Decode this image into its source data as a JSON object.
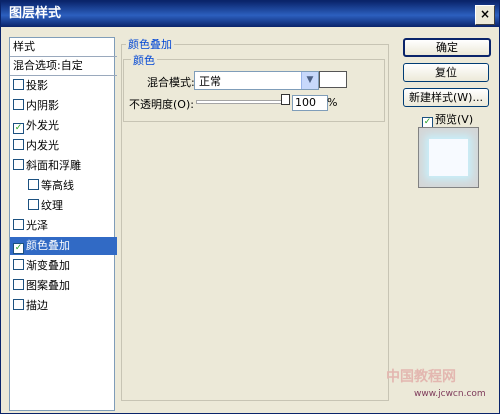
{
  "window": {
    "title": "图层样式",
    "close_glyph": "×"
  },
  "styles_list": {
    "header": "样式",
    "blend_options": "混合选项:自定",
    "items": [
      {
        "label": "投影",
        "checked": false
      },
      {
        "label": "内阴影",
        "checked": false
      },
      {
        "label": "外发光",
        "checked": true
      },
      {
        "label": "内发光",
        "checked": false
      },
      {
        "label": "斜面和浮雕",
        "checked": false
      },
      {
        "label": "等高线",
        "checked": false
      },
      {
        "label": "纹理",
        "checked": false
      },
      {
        "label": "光泽",
        "checked": false
      },
      {
        "label": "颜色叠加",
        "checked": true,
        "selected": true
      },
      {
        "label": "渐变叠加",
        "checked": false
      },
      {
        "label": "图案叠加",
        "checked": false
      },
      {
        "label": "描边",
        "checked": false
      }
    ]
  },
  "color_overlay": {
    "group_title": "颜色叠加",
    "sub_title": "颜色",
    "blend_mode_label": "混合模式:",
    "blend_mode_value": "正常",
    "overlay_color": "#ffffff",
    "opacity_label": "不透明度(O):",
    "opacity_value": "100",
    "opacity_unit": "%"
  },
  "buttons": {
    "ok": "确定",
    "reset": "复位",
    "new_style": "新建样式(W)..."
  },
  "preview": {
    "label": "预览(V)",
    "checked": true
  },
  "watermark": {
    "text": "中国教程网",
    "url": "www.jcwcn.com"
  },
  "check_glyph": "✓"
}
